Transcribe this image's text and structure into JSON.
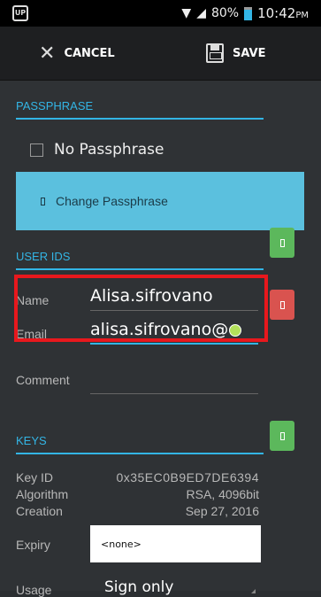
{
  "status_bar": {
    "app_badge": "UP",
    "battery": "80%",
    "time": "10:42",
    "ampm": "PM"
  },
  "action_bar": {
    "cancel_label": "CANCEL",
    "save_label": "SAVE"
  },
  "passphrase": {
    "header": "PASSPHRASE",
    "no_passphrase_label": "No Passphrase",
    "change_button_label": "Change Passphrase"
  },
  "user_ids": {
    "header": "USER IDS",
    "name_label": "Name",
    "name_value": "Alisa.sifrovano",
    "email_label": "Email",
    "email_value": "alisa.sifrovano@",
    "comment_label": "Comment",
    "comment_value": ""
  },
  "keys": {
    "header": "KEYS",
    "key_id_label": "Key ID",
    "key_id_value": "0x35EC0B9ED7DE6394",
    "algorithm_label": "Algorithm",
    "algorithm_value": "RSA, 4096bit",
    "creation_label": "Creation",
    "creation_value": "Sep 27, 2016",
    "expiry_label": "Expiry",
    "expiry_value": "<none>",
    "usage_label": "Usage",
    "usage_value": "Sign only"
  },
  "colors": {
    "accent": "#33b5e5",
    "green_button": "#5cb85c",
    "red_button": "#d9534f",
    "highlight": "#e8181d",
    "background": "#2f3235"
  }
}
